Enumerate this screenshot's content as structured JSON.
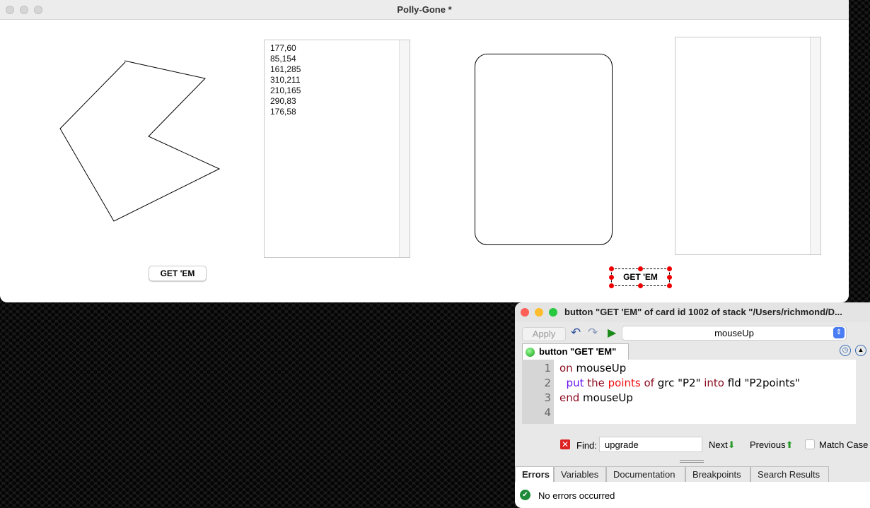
{
  "window": {
    "title": "Polly-Gone *"
  },
  "card": {
    "polygon_points": [
      "177,60",
      "85,154",
      "161,285",
      "310,211",
      "210,165",
      "290,83",
      "176,58"
    ],
    "button_left": "GET 'EM",
    "button_right": "GET 'EM"
  },
  "editor": {
    "title": "button \"GET 'EM\" of card id 1002 of stack \"/Users/richmond/D...",
    "apply": "Apply",
    "handler": "mouseUp",
    "object_tab": "button \"GET 'EM\"",
    "line_numbers": [
      "1",
      "2",
      "3",
      "4"
    ],
    "code": {
      "l1a": "on",
      "l1b": " mouseUp",
      "l2pad": "  ",
      "l2a": "put",
      "l2b": " the",
      "l2c": " points",
      "l2d": " of",
      "l2e": " grc \"P2\" ",
      "l2f": "into",
      "l2g": " fld \"P2points\"",
      "l3a": "end",
      "l3b": " mouseUp"
    },
    "find_label": "Find:",
    "find_value": "upgrade",
    "next": "Next",
    "previous": "Previous",
    "match_case": "Match Case",
    "tabs": [
      "Errors",
      "Variables",
      "Documentation",
      "Breakpoints",
      "Search Results"
    ],
    "status": "No errors occurred"
  }
}
